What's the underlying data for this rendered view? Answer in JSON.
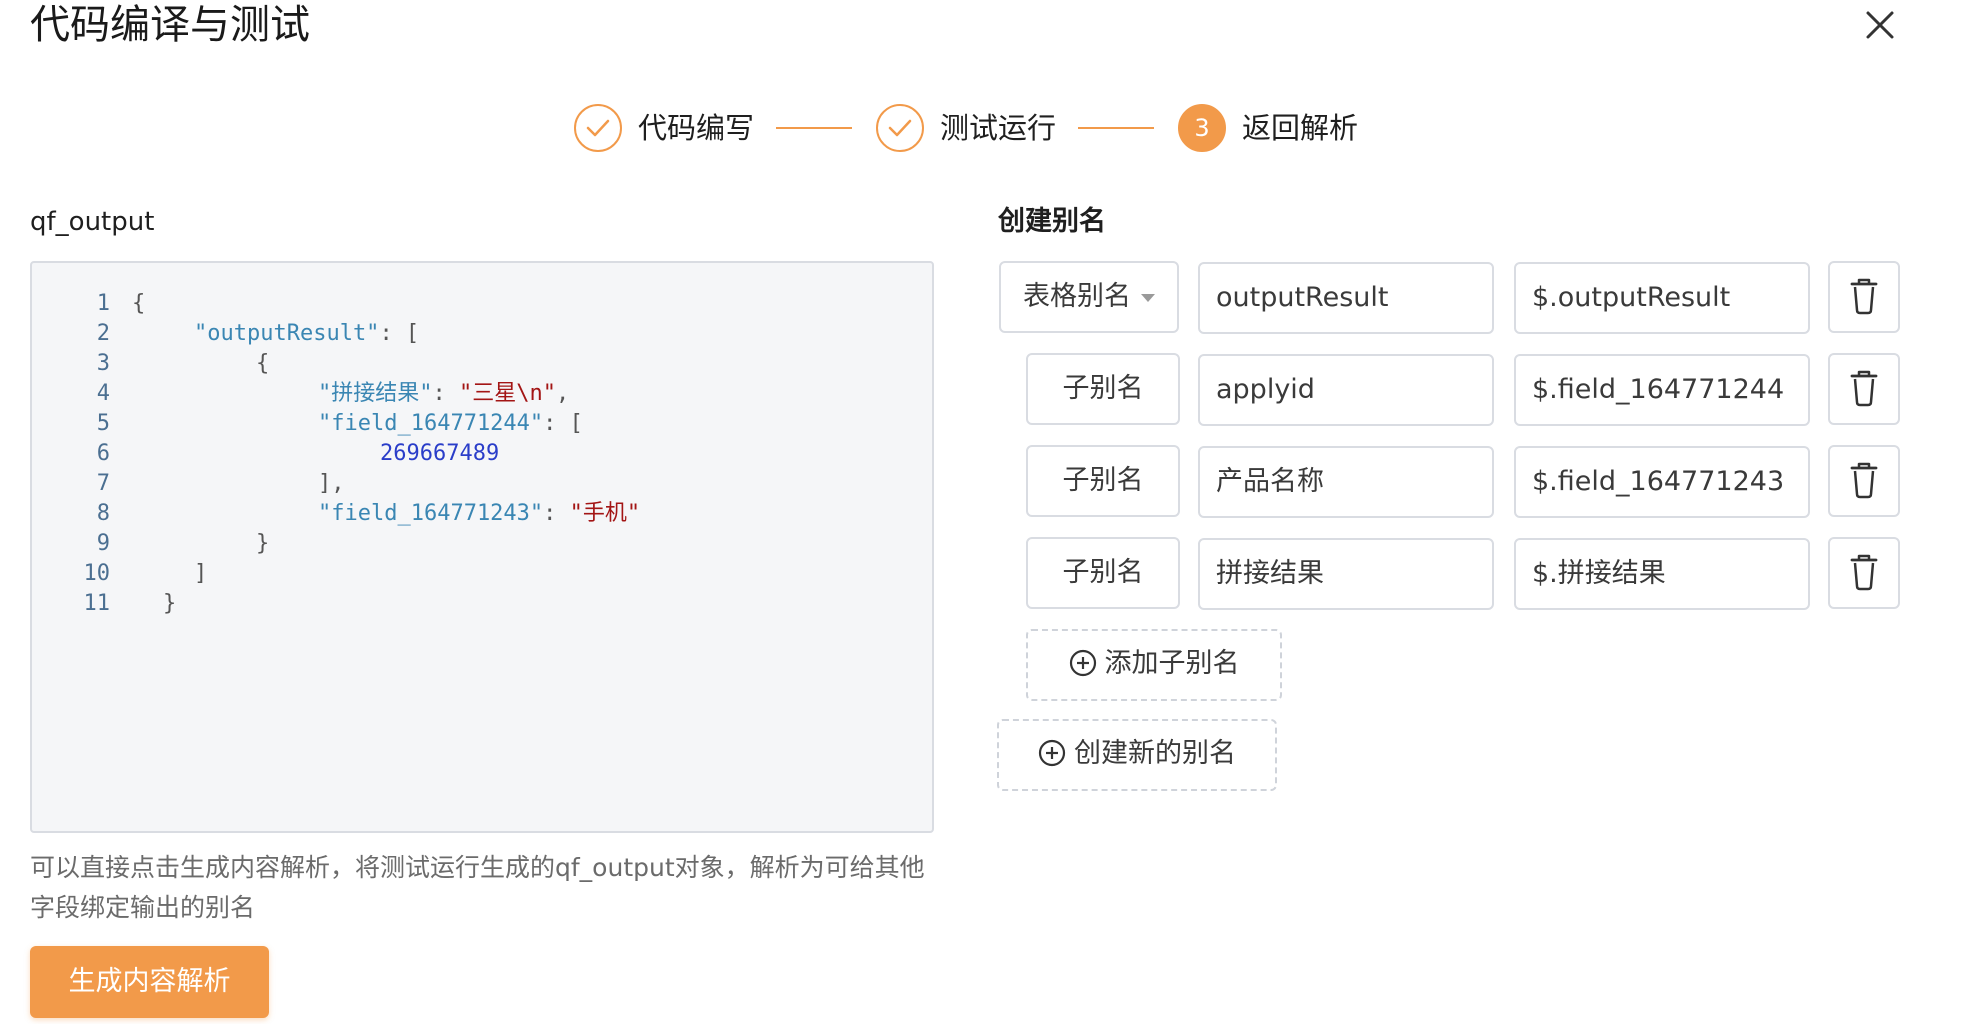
{
  "dialog": {
    "title": "代码编译与测试"
  },
  "steps": [
    {
      "label": "代码编写",
      "status": "done"
    },
    {
      "label": "测试运行",
      "status": "done"
    },
    {
      "label": "返回解析",
      "status": "active",
      "number": "3"
    }
  ],
  "left": {
    "field_label": "qf_output",
    "code_lines": [
      {
        "n": "1",
        "tokens": [
          {
            "t": "{",
            "c": "pun"
          }
        ],
        "indent": 0
      },
      {
        "n": "2",
        "tokens": [
          {
            "t": "\"outputResult\"",
            "c": "key"
          },
          {
            "t": ": [",
            "c": "pun"
          }
        ],
        "indent": 2
      },
      {
        "n": "3",
        "tokens": [
          {
            "t": "{",
            "c": "pun"
          }
        ],
        "indent": 4
      },
      {
        "n": "4",
        "tokens": [
          {
            "t": "\"拼接结果\"",
            "c": "key"
          },
          {
            "t": ": ",
            "c": "pun"
          },
          {
            "t": "\"三星\\n\"",
            "c": "str"
          },
          {
            "t": ",",
            "c": "pun"
          }
        ],
        "indent": 6
      },
      {
        "n": "5",
        "tokens": [
          {
            "t": "\"field_164771244\"",
            "c": "key"
          },
          {
            "t": ": [",
            "c": "pun"
          }
        ],
        "indent": 6
      },
      {
        "n": "6",
        "tokens": [
          {
            "t": "269667489",
            "c": "num"
          }
        ],
        "indent": 8
      },
      {
        "n": "7",
        "tokens": [
          {
            "t": "],",
            "c": "pun"
          }
        ],
        "indent": 6
      },
      {
        "n": "8",
        "tokens": [
          {
            "t": "\"field_164771243\"",
            "c": "key"
          },
          {
            "t": ": ",
            "c": "pun"
          },
          {
            "t": "\"手机\"",
            "c": "str"
          }
        ],
        "indent": 6
      },
      {
        "n": "9",
        "tokens": [
          {
            "t": "}",
            "c": "pun"
          }
        ],
        "indent": 4
      },
      {
        "n": "10",
        "tokens": [
          {
            "t": "]",
            "c": "pun"
          }
        ],
        "indent": 2
      },
      {
        "n": "11",
        "tokens": [
          {
            "t": "}",
            "c": "pun"
          }
        ],
        "indent": 1
      }
    ],
    "hint": "可以直接点击生成内容解析，将测试运行生成的qf_output对象，解析为可给其他字段绑定输出的别名",
    "generate_button": "生成内容解析"
  },
  "right": {
    "section_title": "创建别名",
    "alias_rows": [
      {
        "type": "表格别名",
        "has_dropdown": true,
        "name": "outputResult",
        "path": "$.outputResult"
      },
      {
        "type": "子别名",
        "has_dropdown": false,
        "name": "applyid",
        "path": "$.field_164771244"
      },
      {
        "type": "子别名",
        "has_dropdown": false,
        "name": "产品名称",
        "path": "$.field_164771243"
      },
      {
        "type": "子别名",
        "has_dropdown": false,
        "name": "拼接结果",
        "path": "$.拼接结果"
      }
    ],
    "add_sub_alias": "添加子别名",
    "create_new_alias": "创建新的别名"
  },
  "colors": {
    "accent": "#f29a4a",
    "key": "#3a86b3",
    "string": "#a31515",
    "number": "#2a3dc9"
  },
  "icons": {
    "close": "close-icon",
    "check": "check-icon",
    "trash": "trash-icon",
    "plus": "plus-circle-icon"
  }
}
